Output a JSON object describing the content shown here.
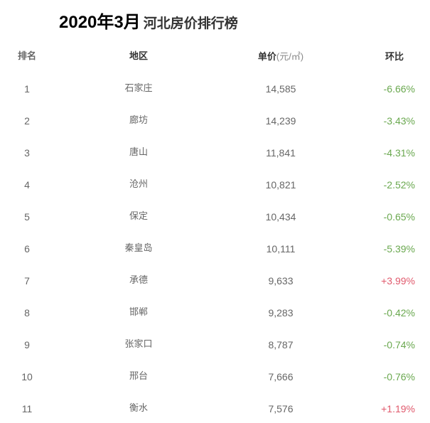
{
  "title": {
    "date": "2020年3月",
    "name": "河北房价排行榜"
  },
  "header": {
    "rank": "排名",
    "region": "地区",
    "price": "单价",
    "price_unit": "(元/㎡)",
    "change": "环比"
  },
  "colors": {
    "negative": "#6aa84f",
    "positive": "#e05a6d"
  },
  "rows": [
    {
      "rank": "1",
      "region": "石家庄",
      "price": "14,585",
      "change": "-6.66%",
      "trend": "neg"
    },
    {
      "rank": "2",
      "region": "廊坊",
      "price": "14,239",
      "change": "-3.43%",
      "trend": "neg"
    },
    {
      "rank": "3",
      "region": "唐山",
      "price": "11,841",
      "change": "-4.31%",
      "trend": "neg"
    },
    {
      "rank": "4",
      "region": "沧州",
      "price": "10,821",
      "change": "-2.52%",
      "trend": "neg"
    },
    {
      "rank": "5",
      "region": "保定",
      "price": "10,434",
      "change": "-0.65%",
      "trend": "neg"
    },
    {
      "rank": "6",
      "region": "秦皇岛",
      "price": "10,111",
      "change": "-5.39%",
      "trend": "neg"
    },
    {
      "rank": "7",
      "region": "承德",
      "price": "9,633",
      "change": "+3.99%",
      "trend": "pos"
    },
    {
      "rank": "8",
      "region": "邯郸",
      "price": "9,283",
      "change": "-0.42%",
      "trend": "neg"
    },
    {
      "rank": "9",
      "region": "张家口",
      "price": "8,787",
      "change": "-0.74%",
      "trend": "neg"
    },
    {
      "rank": "10",
      "region": "邢台",
      "price": "7,666",
      "change": "-0.76%",
      "trend": "neg"
    },
    {
      "rank": "11",
      "region": "衡水",
      "price": "7,576",
      "change": "+1.19%",
      "trend": "pos"
    }
  ]
}
